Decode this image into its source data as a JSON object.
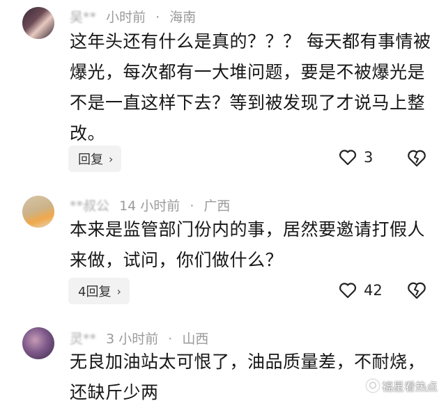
{
  "comments": [
    {
      "name": "吴**",
      "time": "小时前",
      "location": "海南",
      "text": "这年头还有什么是真的？？？ 每天都有事情被爆光，每次都有一大堆问题，要是不被爆光是不是一直这样下去？等到被发现了才说马上整改。",
      "reply_label": "回复",
      "likes": "3"
    },
    {
      "name": "**叔公",
      "time": "14 小时前",
      "location": "广西",
      "text": "本来是监管部门份内的事，居然要邀请打假人来做，试问，你们做什么？",
      "reply_label": "4回复",
      "likes": "42"
    },
    {
      "name": "灵**",
      "time": "3 小时前",
      "location": "山西",
      "text": "无良加油站太可恨了，油品质量差，不耐烧，还缺斤少两"
    }
  ],
  "separator": "·",
  "chevron": "›",
  "watermark": "福星看热点"
}
